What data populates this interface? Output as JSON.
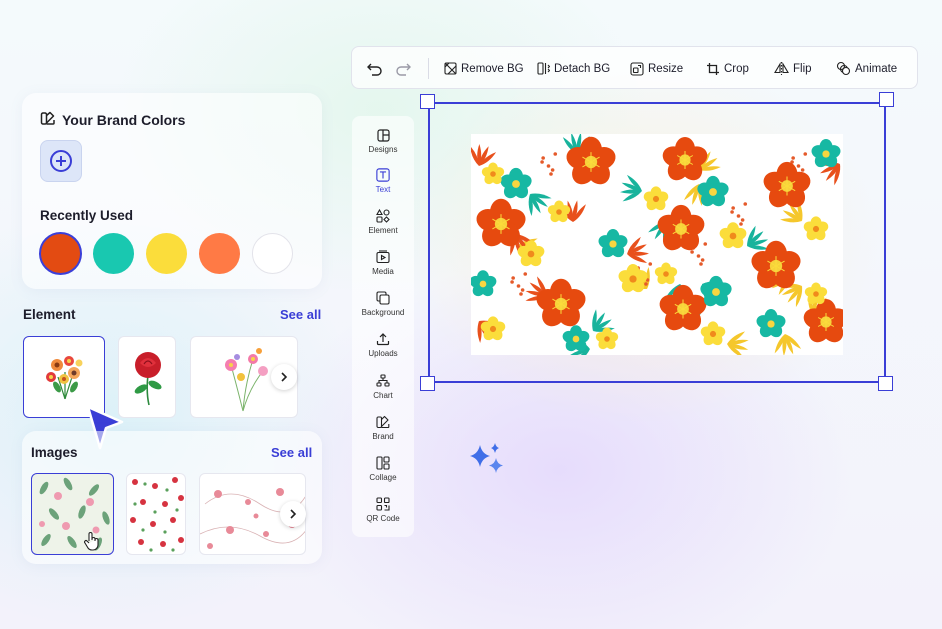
{
  "brand": {
    "title": "Your Brand Colors",
    "recent_label": "Recently Used",
    "swatches": [
      "#e34b12",
      "#19c8b0",
      "#fbdd3b",
      "#ff7a45",
      "#ffffff"
    ]
  },
  "element": {
    "title": "Element",
    "see_all": "See all"
  },
  "images": {
    "title": "Images",
    "see_all": "See all"
  },
  "sidebar": {
    "items": [
      {
        "label": "Designs",
        "icon": "designs-icon"
      },
      {
        "label": "Text",
        "icon": "text-icon"
      },
      {
        "label": "Element",
        "icon": "element-icon"
      },
      {
        "label": "Media",
        "icon": "media-icon"
      },
      {
        "label": "Background",
        "icon": "background-icon"
      },
      {
        "label": "Uploads",
        "icon": "upload-icon"
      },
      {
        "label": "Chart",
        "icon": "chart-icon"
      },
      {
        "label": "Brand",
        "icon": "brand-icon"
      },
      {
        "label": "Collage",
        "icon": "collage-icon"
      },
      {
        "label": "QR Code",
        "icon": "qr-code-icon"
      }
    ]
  },
  "toolbar": {
    "remove_bg": "Remove BG",
    "detach_bg": "Detach BG",
    "resize": "Resize",
    "crop": "Crop",
    "flip": "Flip",
    "animate": "Animate"
  },
  "colors": {
    "accent": "#3a3ed6",
    "orange": "#e64a0f",
    "teal": "#17b8a3",
    "yellow": "#fbdd3b"
  }
}
